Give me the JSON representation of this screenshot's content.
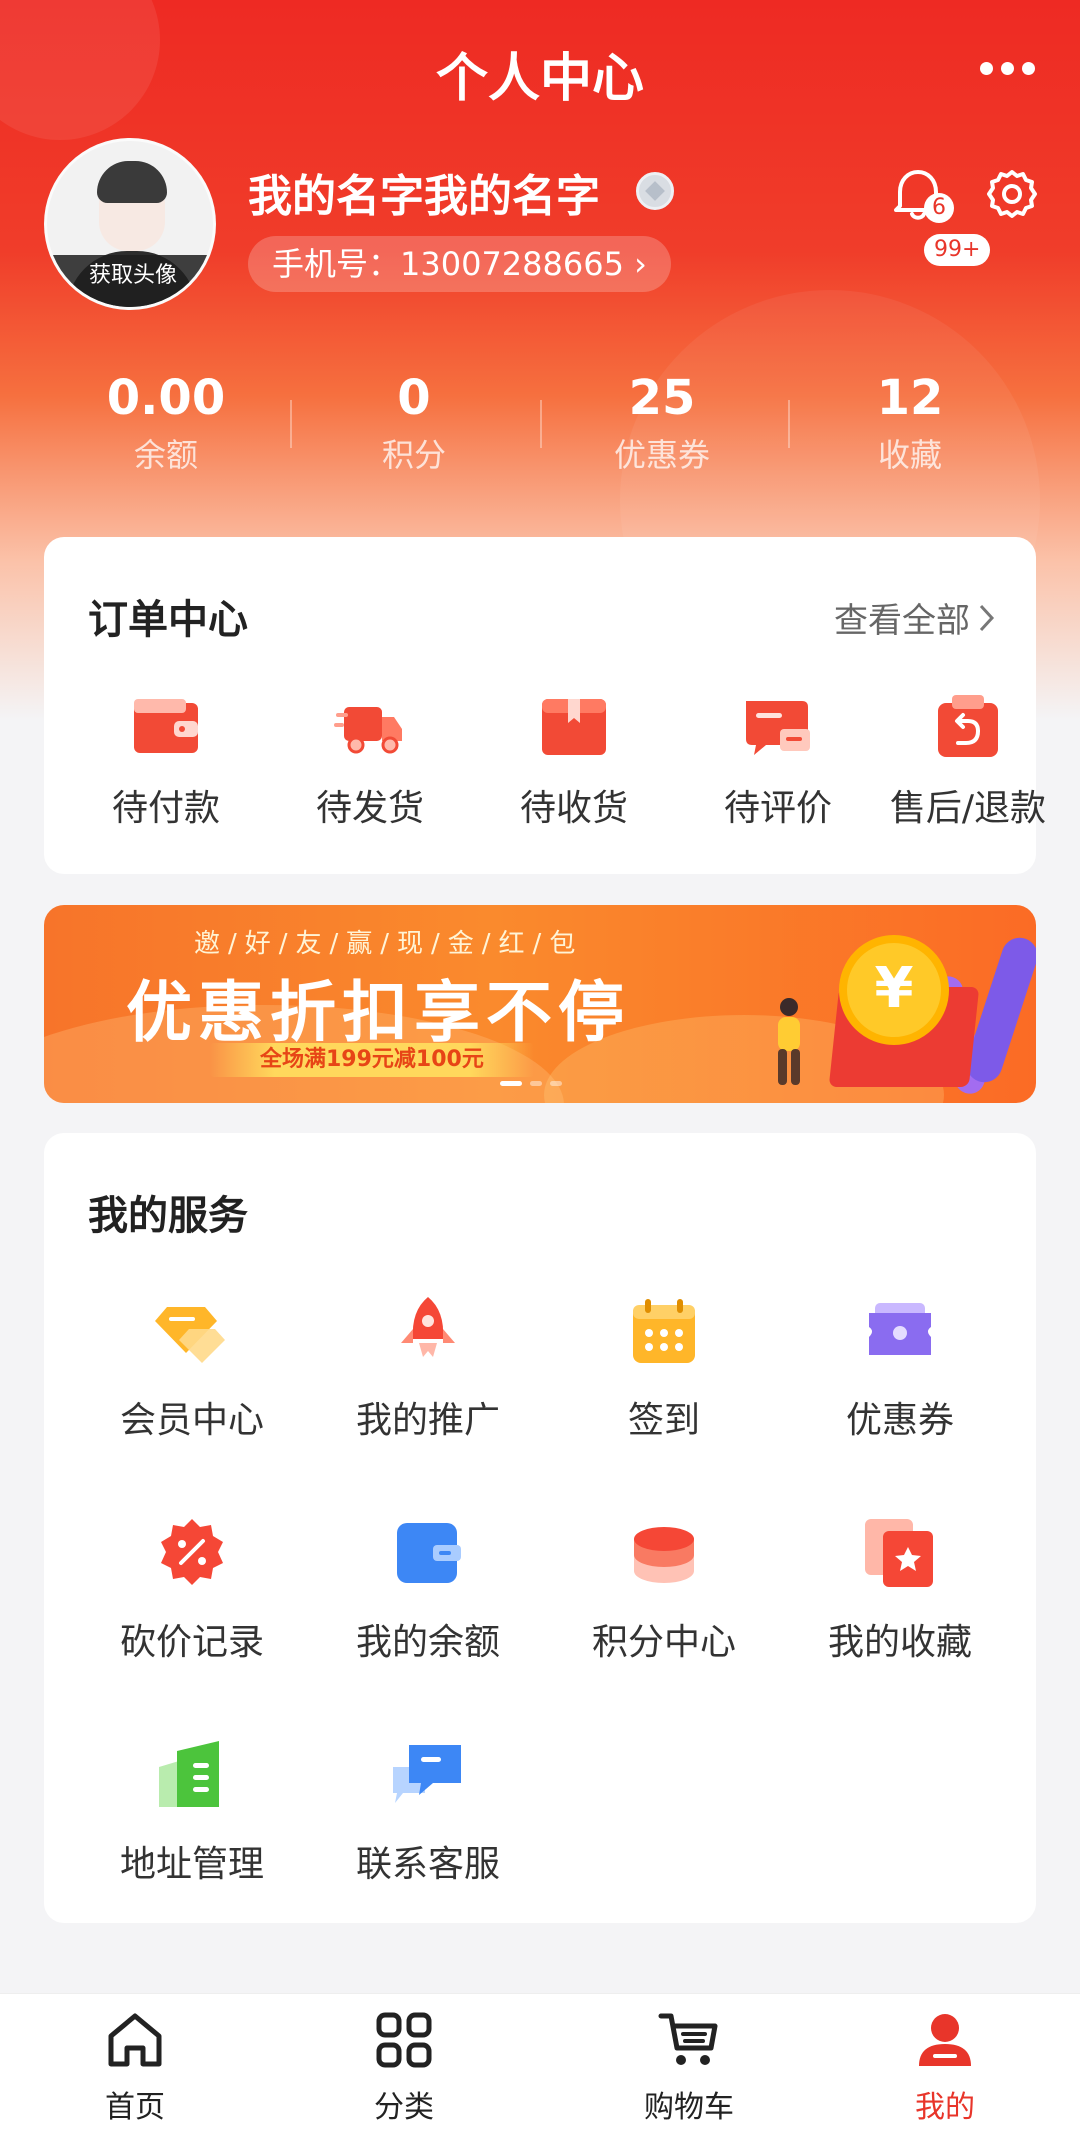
{
  "header": {
    "title": "个人中心"
  },
  "profile": {
    "avatar_caption": "获取头像",
    "name": "我的名字我的名字",
    "phone": "手机号：13007288665 ›",
    "notification_badge": "6",
    "notification_count": "99+"
  },
  "stats": [
    {
      "value": "0.00",
      "label": "余额"
    },
    {
      "value": "0",
      "label": "积分"
    },
    {
      "value": "25",
      "label": "优惠券"
    },
    {
      "value": "12",
      "label": "收藏"
    }
  ],
  "orders": {
    "title": "订单中心",
    "view_all": "查看全部",
    "items": [
      {
        "label": "待付款",
        "icon": "wallet-icon"
      },
      {
        "label": "待发货",
        "icon": "truck-icon"
      },
      {
        "label": "待收货",
        "icon": "package-icon"
      },
      {
        "label": "待评价",
        "icon": "review-icon"
      },
      {
        "label": "售后/退款",
        "icon": "refund-icon"
      }
    ]
  },
  "banner": {
    "subtitle": "邀/好/友/赢/现/金/红/包",
    "headline": "优惠折扣享不停",
    "tag": "全场满199元减100元",
    "coin_symbol": "¥"
  },
  "services": {
    "title": "我的服务",
    "items": [
      {
        "label": "会员中心",
        "icon": "vip-icon"
      },
      {
        "label": "我的推广",
        "icon": "rocket-icon"
      },
      {
        "label": "签到",
        "icon": "calendar-icon"
      },
      {
        "label": "优惠券",
        "icon": "coupon-icon"
      },
      {
        "label": "砍价记录",
        "icon": "discount-icon"
      },
      {
        "label": "我的余额",
        "icon": "balance-icon"
      },
      {
        "label": "积分中心",
        "icon": "points-icon"
      },
      {
        "label": "我的收藏",
        "icon": "favorite-icon"
      },
      {
        "label": "地址管理",
        "icon": "address-icon"
      },
      {
        "label": "联系客服",
        "icon": "service-chat-icon"
      }
    ]
  },
  "tabbar": {
    "items": [
      {
        "label": "首页",
        "icon": "home-icon"
      },
      {
        "label": "分类",
        "icon": "category-icon"
      },
      {
        "label": "购物车",
        "icon": "cart-icon"
      },
      {
        "label": "我的",
        "icon": "user-icon"
      }
    ],
    "active_index": 3
  },
  "colors": {
    "brand_red": "#e8352a",
    "banner_orange": "#f7742a",
    "background": "#f4f4f6"
  }
}
